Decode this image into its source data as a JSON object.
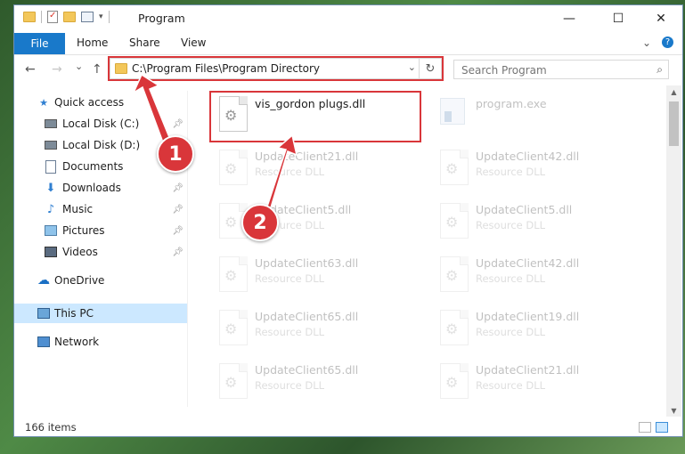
{
  "window": {
    "title": "Program",
    "controls": {
      "minimize": "—",
      "maximize": "☐",
      "close": "✕"
    }
  },
  "ribbon": {
    "file": "File",
    "tabs": [
      "Home",
      "Share",
      "View"
    ],
    "expand_icon": "chevron-down",
    "help": "?"
  },
  "nav_buttons": {
    "back": "←",
    "forward": "→",
    "down": "⌄",
    "up": "↑"
  },
  "address": {
    "path": "C:\\Program Files\\Program Directory",
    "dropdown": "⌄",
    "refresh": "↻"
  },
  "search": {
    "placeholder": "Search Program",
    "icon": "⌕"
  },
  "nav_pane": {
    "items": [
      {
        "label": "Quick access",
        "icon": "star-icon",
        "pinned": false
      },
      {
        "label": "Local Disk (C:)",
        "icon": "drive-icon",
        "pinned": true
      },
      {
        "label": "Local Disk (D:)",
        "icon": "drive-icon",
        "pinned": false
      },
      {
        "label": "Documents",
        "icon": "documents-icon",
        "pinned": true
      },
      {
        "label": "Downloads",
        "icon": "download-icon",
        "pinned": true
      },
      {
        "label": "Music",
        "icon": "music-icon",
        "pinned": true
      },
      {
        "label": "Pictures",
        "icon": "pictures-icon",
        "pinned": true
      },
      {
        "label": "Videos",
        "icon": "videos-icon",
        "pinned": true
      },
      {
        "label": "OneDrive",
        "icon": "cloud-icon",
        "pinned": false
      },
      {
        "label": "This PC",
        "icon": "computer-icon",
        "pinned": false,
        "selected": true
      },
      {
        "label": "Network",
        "icon": "network-icon",
        "pinned": false
      }
    ]
  },
  "files": {
    "highlighted": {
      "name": "vis_gordon plugs.dll"
    },
    "exe": {
      "name": "program.exe"
    },
    "items": [
      {
        "name": "UpdateClient21.dll",
        "type": "Resource DLL"
      },
      {
        "name": "UpdateClient42.dll",
        "type": "Resource DLL"
      },
      {
        "name": "UpdateClient5.dll",
        "type": "Resource DLL"
      },
      {
        "name": "UpdateClient5.dll",
        "type": "Resource DLL"
      },
      {
        "name": "UpdateClient63.dll",
        "type": "Resource DLL"
      },
      {
        "name": "UpdateClient42.dll",
        "type": "Resource DLL"
      },
      {
        "name": "UpdateClient65.dll",
        "type": "Resource DLL"
      },
      {
        "name": "UpdateClient19.dll",
        "type": "Resource DLL"
      },
      {
        "name": "UpdateClient65.dll",
        "type": "Resource DLL"
      },
      {
        "name": "UpdateClient21.dll",
        "type": "Resource DLL"
      }
    ]
  },
  "status": {
    "count": "166 items"
  },
  "annotations": {
    "step1": "1",
    "step2": "2",
    "color": "#d9363a"
  }
}
